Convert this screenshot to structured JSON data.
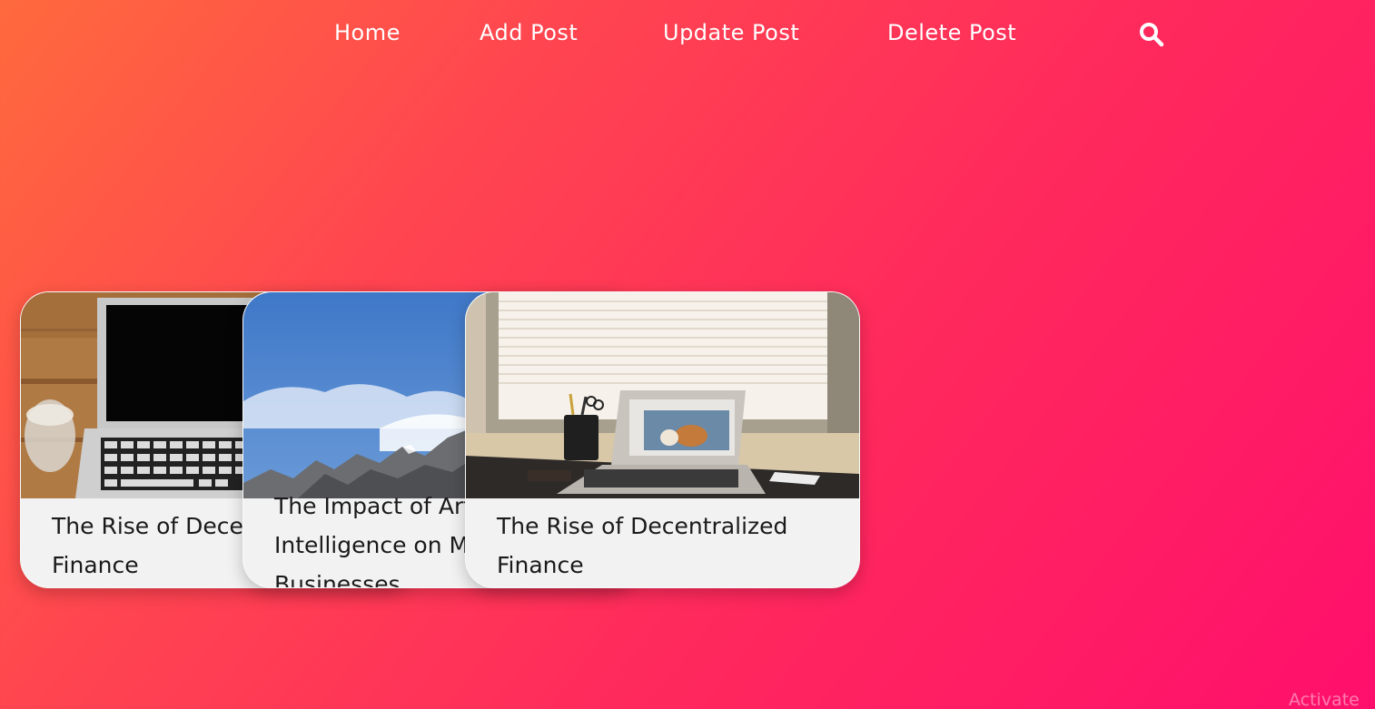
{
  "nav": {
    "links": [
      {
        "label": "Home"
      },
      {
        "label": "Add Post"
      },
      {
        "label": "Update Post"
      },
      {
        "label": "Delete Post"
      }
    ],
    "search_icon": "search-icon"
  },
  "posts": [
    {
      "title": "The Rise of Decentralized Finance",
      "image": "laptop-on-wooden-desk-with-glass"
    },
    {
      "title": "The Impact of Artificial Intelligence on Modern Businesses",
      "image": "mountain-under-blue-sky"
    },
    {
      "title": "The Rise of Decentralized Finance",
      "image": "laptop-on-desk-by-window"
    }
  ],
  "watermark": "Activate",
  "colors": {
    "gradient_start": "#ff6a3d",
    "gradient_end": "#ff0f6c",
    "card_bg": "#f2f2f2",
    "nav_text": "#ffffff"
  }
}
